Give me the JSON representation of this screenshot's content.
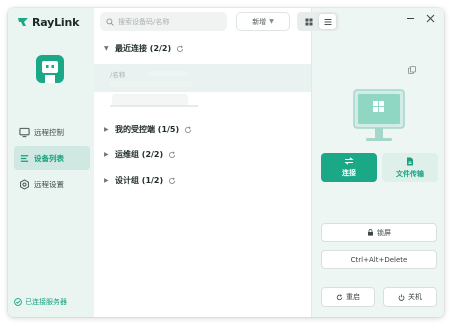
{
  "app": {
    "name": "RayLink",
    "brand_color": "#1aa886"
  },
  "sidebar": {
    "items": [
      {
        "label": "远程控制",
        "icon": "monitor-icon",
        "active": false
      },
      {
        "label": "设备列表",
        "icon": "list-icon",
        "active": true
      },
      {
        "label": "远程设置",
        "icon": "settings-icon",
        "active": false
      }
    ],
    "status": "已连接服务器"
  },
  "toolbar": {
    "search_placeholder": "搜索设备码/名称",
    "add_label": "新增"
  },
  "groups": [
    {
      "label": "最近连接 (2/2)",
      "expanded": true
    },
    {
      "label": "我的受控端 (1/5)",
      "expanded": false
    },
    {
      "label": "运维组 (2/2)",
      "expanded": false
    },
    {
      "label": "设计组 (1/2)",
      "expanded": false
    }
  ],
  "device": {
    "name": "/名称"
  },
  "panel": {
    "connect_label": "连接",
    "transfer_label": "文件传输",
    "lock_label": "锁屏",
    "cad_label": "Ctrl+Alt+Delete",
    "restart_label": "重启",
    "shutdown_label": "关机"
  }
}
